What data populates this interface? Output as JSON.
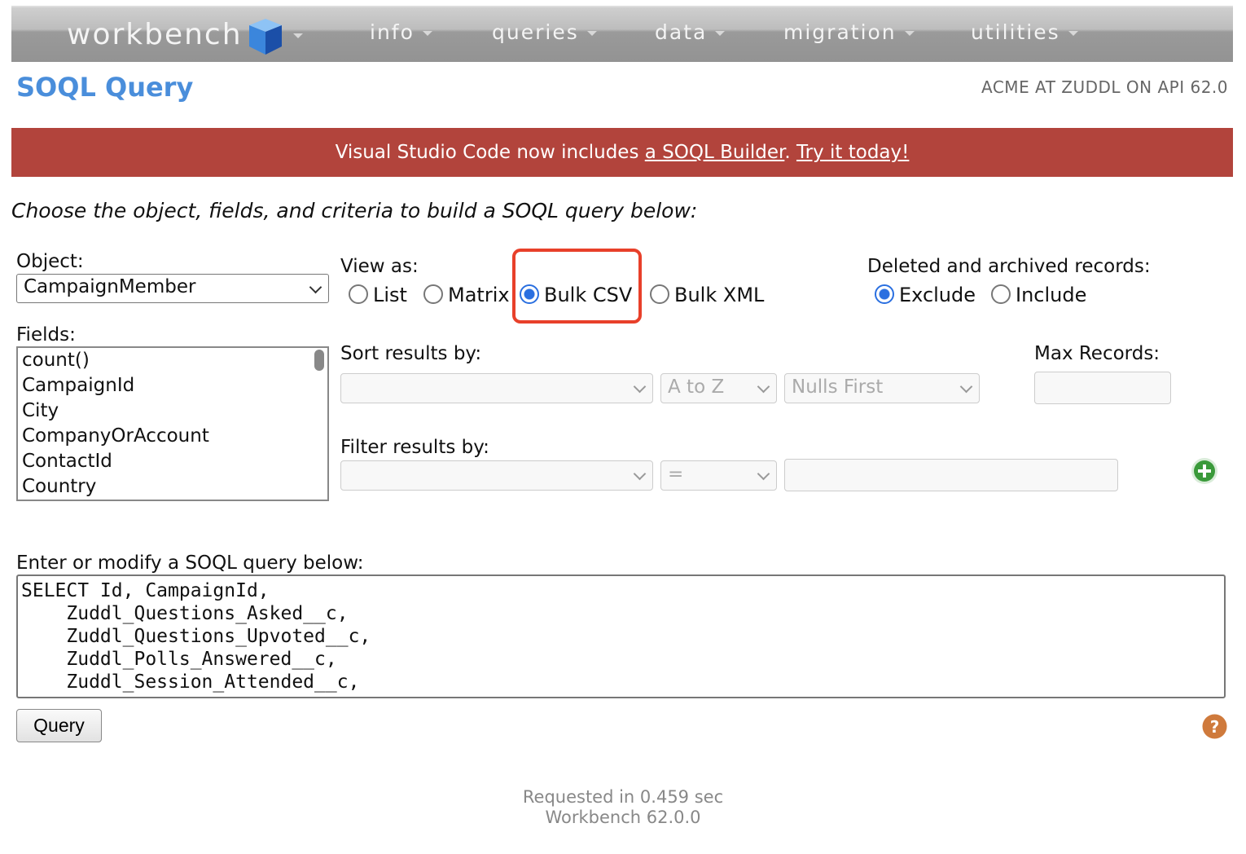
{
  "nav": {
    "logo": "workbench",
    "items": [
      "info",
      "queries",
      "data",
      "migration",
      "utilities"
    ]
  },
  "header": {
    "title": "SOQL Query",
    "org": "ACME AT ZUDDL ON API 62.0"
  },
  "banner": {
    "text1": "Visual Studio Code now includes ",
    "link1": "a SOQL Builder",
    "text2": ". ",
    "link2": "Try it today!"
  },
  "intro": "Choose the object, fields, and criteria to build a SOQL query below:",
  "object": {
    "label": "Object:",
    "value": "CampaignMember"
  },
  "view_as": {
    "label": "View as:",
    "options": [
      "List",
      "Matrix",
      "Bulk CSV",
      "Bulk XML"
    ],
    "selected": "Bulk CSV"
  },
  "deleted": {
    "label": "Deleted and archived records:",
    "options": [
      "Exclude",
      "Include"
    ],
    "selected": "Exclude"
  },
  "fields": {
    "label": "Fields:",
    "items": [
      "count()",
      "CampaignId",
      "City",
      "CompanyOrAccount",
      "ContactId",
      "Country"
    ]
  },
  "sort": {
    "label": "Sort results by:",
    "field": "",
    "order": "A to Z",
    "nulls": "Nulls First"
  },
  "max_records": {
    "label": "Max Records:",
    "value": ""
  },
  "filter": {
    "label": "Filter results by:",
    "field": "",
    "operator": "=",
    "value": ""
  },
  "query": {
    "label": "Enter or modify a SOQL query below:",
    "text": "SELECT Id, CampaignId,\n    Zuddl_Questions_Asked__c,\n    Zuddl_Questions_Upvoted__c,\n    Zuddl_Polls_Answered__c,\n    Zuddl_Session_Attended__c,",
    "button": "Query"
  },
  "footer": {
    "timing": "Requested in 0.459 sec",
    "version": "Workbench 62.0.0"
  },
  "colors": {
    "accent": "#4a8edb",
    "banner": "#b2443c",
    "highlight": "#e8402a"
  }
}
